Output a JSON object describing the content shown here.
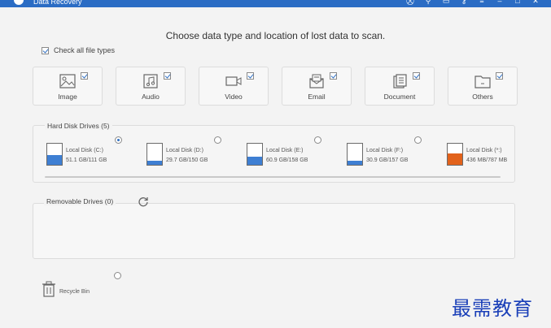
{
  "window": {
    "title": "Data Recovery",
    "title_icons": [
      "cart-icon",
      "pin-icon",
      "chat-icon",
      "key-icon",
      "menu-icon",
      "minimize-icon",
      "maximize-icon",
      "close-icon"
    ]
  },
  "heading": "Choose data type and location of lost data to scan.",
  "check_all": {
    "label": "Check all file types",
    "checked": true
  },
  "file_types": [
    {
      "label": "Image",
      "icon": "image-icon",
      "checked": true
    },
    {
      "label": "Audio",
      "icon": "audio-icon",
      "checked": true
    },
    {
      "label": "Video",
      "icon": "video-icon",
      "checked": true
    },
    {
      "label": "Email",
      "icon": "email-icon",
      "checked": true
    },
    {
      "label": "Document",
      "icon": "document-icon",
      "checked": true
    },
    {
      "label": "Others",
      "icon": "folder-icon",
      "checked": true
    }
  ],
  "hard_disk": {
    "title": "Hard Disk Drives (5)",
    "drives": [
      {
        "name": "Local Disk (C:)",
        "size": "51.1 GB/111 GB",
        "used_fraction": 0.46,
        "selected": true,
        "color": "#3e7fd3",
        "system": true
      },
      {
        "name": "Local Disk (D:)",
        "size": "29.7 GB/150 GB",
        "used_fraction": 0.2,
        "selected": false,
        "color": "#3e7fd3"
      },
      {
        "name": "Local Disk (E:)",
        "size": "60.9 GB/158 GB",
        "used_fraction": 0.39,
        "selected": false,
        "color": "#3e7fd3"
      },
      {
        "name": "Local Disk (F:)",
        "size": "30.9 GB/157 GB",
        "used_fraction": 0.2,
        "selected": false,
        "color": "#3e7fd3"
      },
      {
        "name": "Local Disk (*:)",
        "size": "436 MB/787 MB",
        "used_fraction": 0.55,
        "selected": false,
        "color": "#e2621b"
      }
    ]
  },
  "removable": {
    "title": "Removable Drives (0)"
  },
  "recycle_bin": {
    "label": "Recycle Bin",
    "selected": false
  },
  "watermark": "最需教育"
}
